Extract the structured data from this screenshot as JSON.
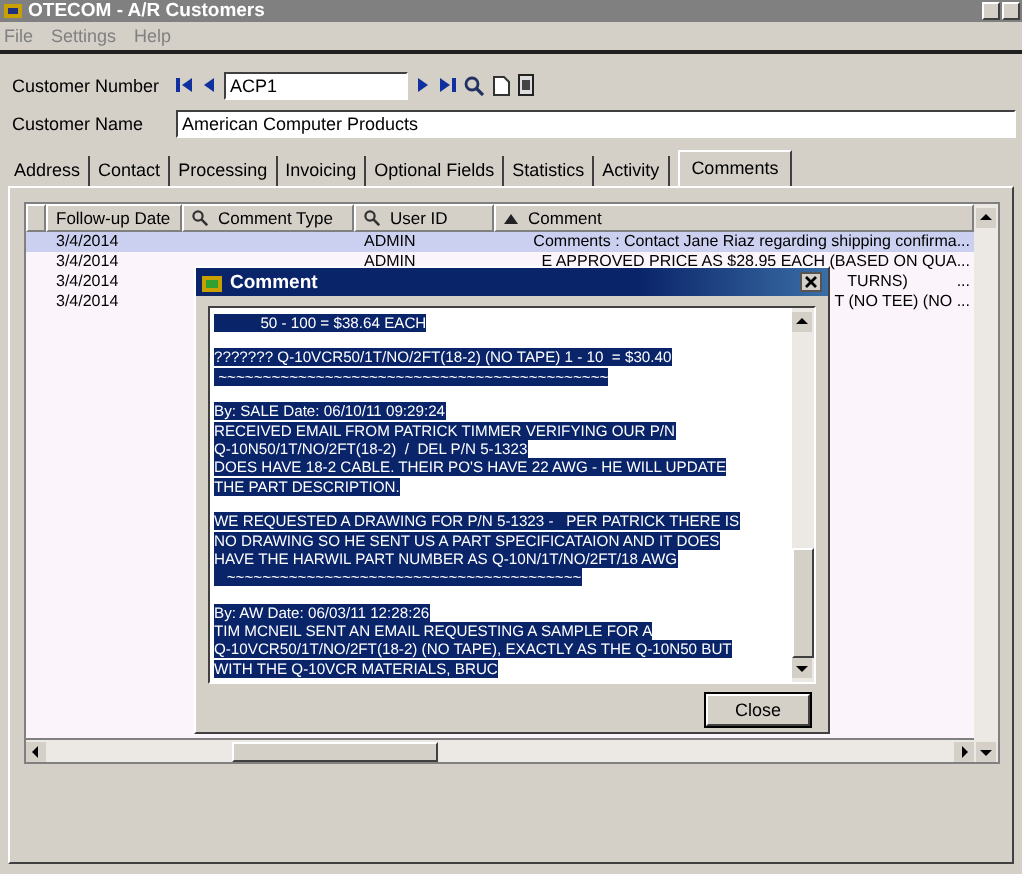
{
  "window": {
    "title": "OTECOM - A/R Customers"
  },
  "menu": [
    {
      "label": "File"
    },
    {
      "label": "Settings"
    },
    {
      "label": "Help"
    }
  ],
  "customer_number": {
    "label": "Customer Number",
    "value": "ACP1"
  },
  "customer_name": {
    "label": "Customer Name",
    "value": "American Computer Products"
  },
  "tabs": [
    {
      "label": "Address",
      "selected": false
    },
    {
      "label": "Contact",
      "selected": false
    },
    {
      "label": "Processing",
      "selected": false
    },
    {
      "label": "Invoicing",
      "selected": false
    },
    {
      "label": "Optional Fields",
      "selected": false
    },
    {
      "label": "Statistics",
      "selected": false
    },
    {
      "label": "Activity",
      "selected": false
    },
    {
      "label": "Comments",
      "selected": true
    }
  ],
  "table": {
    "columns": [
      {
        "label": "Follow-up Date",
        "kind": "plain"
      },
      {
        "label": "Comment Type",
        "kind": "search"
      },
      {
        "label": "User ID",
        "kind": "search"
      },
      {
        "label": "Comment",
        "kind": "sort"
      }
    ],
    "rows": [
      {
        "date": "3/4/2014",
        "user_id": "ADMIN",
        "comment": "Comments : Contact Jane Riaz regarding shipping confirma...",
        "selected": true
      },
      {
        "date": "3/4/2014",
        "user_id": "ADMIN",
        "comment": "E APPROVED PRICE AS $28.95 EACH (BASED ON QUA...",
        "selected": false
      },
      {
        "date": "3/4/2014",
        "comment": "TURNS)           ...",
        "selected": false
      },
      {
        "date": "3/4/2014",
        "comment": "T (NO TEE) (NO ...",
        "selected": false
      }
    ]
  },
  "dialog": {
    "title": "Comment",
    "paragraphs": [
      [
        "           50 - 100 = $38.64 EACH"
      ],
      [
        "??????? Q-10VCR50/1T/NO/2FT(18-2) (NO TAPE) 1 - 10  = $30.40",
        " ~~~~~~~~~~~~~~~~~~~~~~~~~~~~~~~~~~~~~~~~~~~~"
      ],
      [
        "By: SALE Date: 06/10/11 09:29:24",
        "RECEIVED EMAIL FROM PATRICK TIMMER VERIFYING OUR P/N",
        "Q-10N50/1T/NO/2FT(18-2)  /  DEL P/N 5-1323",
        "DOES HAVE 18-2 CABLE. THEIR PO'S HAVE 22 AWG - HE WILL UPDATE",
        "THE PART DESCRIPTION."
      ],
      [
        "WE REQUESTED A DRAWING FOR P/N 5-1323 -   PER PATRICK THERE IS",
        "NO DRAWING SO HE SENT US A PART SPECIFICATAION AND IT DOES",
        "HAVE THE HARWIL PART NUMBER AS Q-10N/1T/NO/2FT/18 AWG",
        "   ~~~~~~~~~~~~~~~~~~~~~~~~~~~~~~~~~~~~~~~~"
      ],
      [
        "By: AW Date: 06/03/11 12:28:26",
        "TIM MCNEIL SENT AN EMAIL REQUESTING A SAMPLE FOR A",
        "Q-10VCR50/1T/NO/2FT(18-2) (NO TAPE), EXACTLY AS THE Q-10N50 BUT",
        "WITH THE Q-10VCR MATERIALS, BRUC"
      ]
    ],
    "close_button": "Close"
  }
}
